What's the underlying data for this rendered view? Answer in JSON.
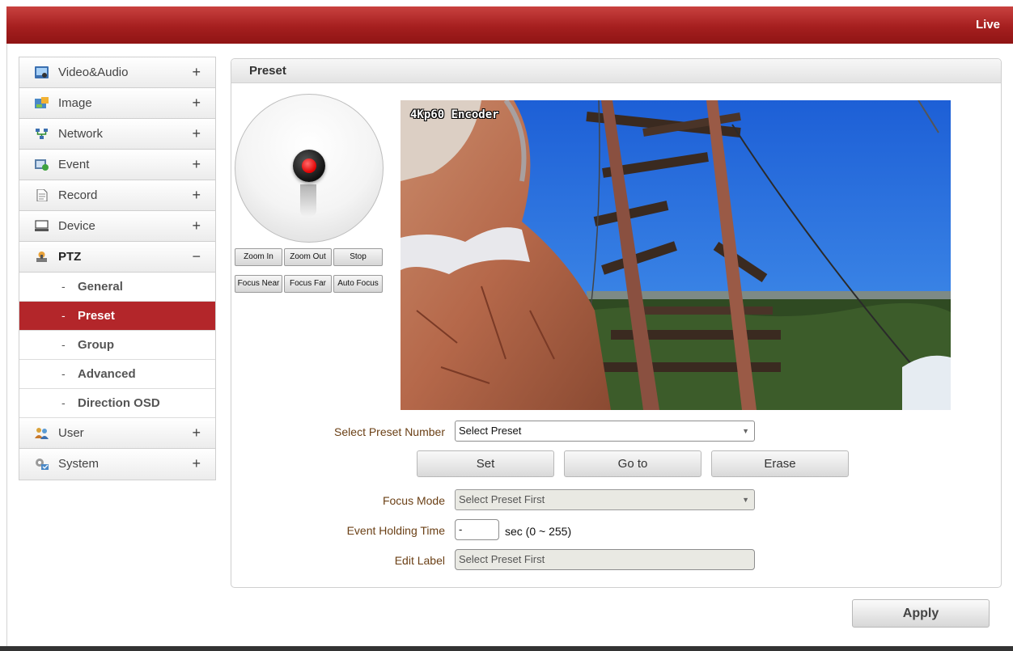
{
  "header": {
    "live_link": "Live",
    "accent_color": "#a51f1f"
  },
  "sidebar": {
    "items": [
      {
        "label": "Video&Audio",
        "sign": "+",
        "icon": "video-audio-icon"
      },
      {
        "label": "Image",
        "sign": "+",
        "icon": "image-icon"
      },
      {
        "label": "Network",
        "sign": "+",
        "icon": "network-icon"
      },
      {
        "label": "Event",
        "sign": "+",
        "icon": "event-icon"
      },
      {
        "label": "Record",
        "sign": "+",
        "icon": "record-icon"
      },
      {
        "label": "Device",
        "sign": "+",
        "icon": "device-icon"
      },
      {
        "label": "PTZ",
        "sign": "−",
        "icon": "ptz-icon"
      },
      {
        "label": "User",
        "sign": "+",
        "icon": "user-icon"
      },
      {
        "label": "System",
        "sign": "+",
        "icon": "system-icon"
      }
    ],
    "ptz_submenu": [
      {
        "bullet": "-",
        "label": "General"
      },
      {
        "bullet": "-",
        "label": "Preset",
        "active": true
      },
      {
        "bullet": "-",
        "label": "Group"
      },
      {
        "bullet": "-",
        "label": "Advanced"
      },
      {
        "bullet": "-",
        "label": "Direction OSD"
      }
    ],
    "active_color": "#b3262a"
  },
  "panel": {
    "title": "Preset"
  },
  "ptz_controls": {
    "buttons_row1": [
      "Zoom In",
      "Zoom Out",
      "Stop"
    ],
    "buttons_row2": [
      "Focus Near",
      "Focus Far",
      "Auto Focus"
    ]
  },
  "video": {
    "osd": "4Kp60 Encoder"
  },
  "form": {
    "preset_number": {
      "label": "Select Preset Number",
      "value": "Select Preset"
    },
    "buttons": {
      "set": "Set",
      "goto": "Go to",
      "erase": "Erase"
    },
    "focus_mode": {
      "label": "Focus Mode",
      "value": "Select Preset First"
    },
    "event_holding_time": {
      "label": "Event Holding Time",
      "value": "-",
      "unit": "sec (0 ~ 255)"
    },
    "edit_label": {
      "label": "Edit Label",
      "value": "Select Preset First"
    }
  },
  "apply_label": "Apply"
}
